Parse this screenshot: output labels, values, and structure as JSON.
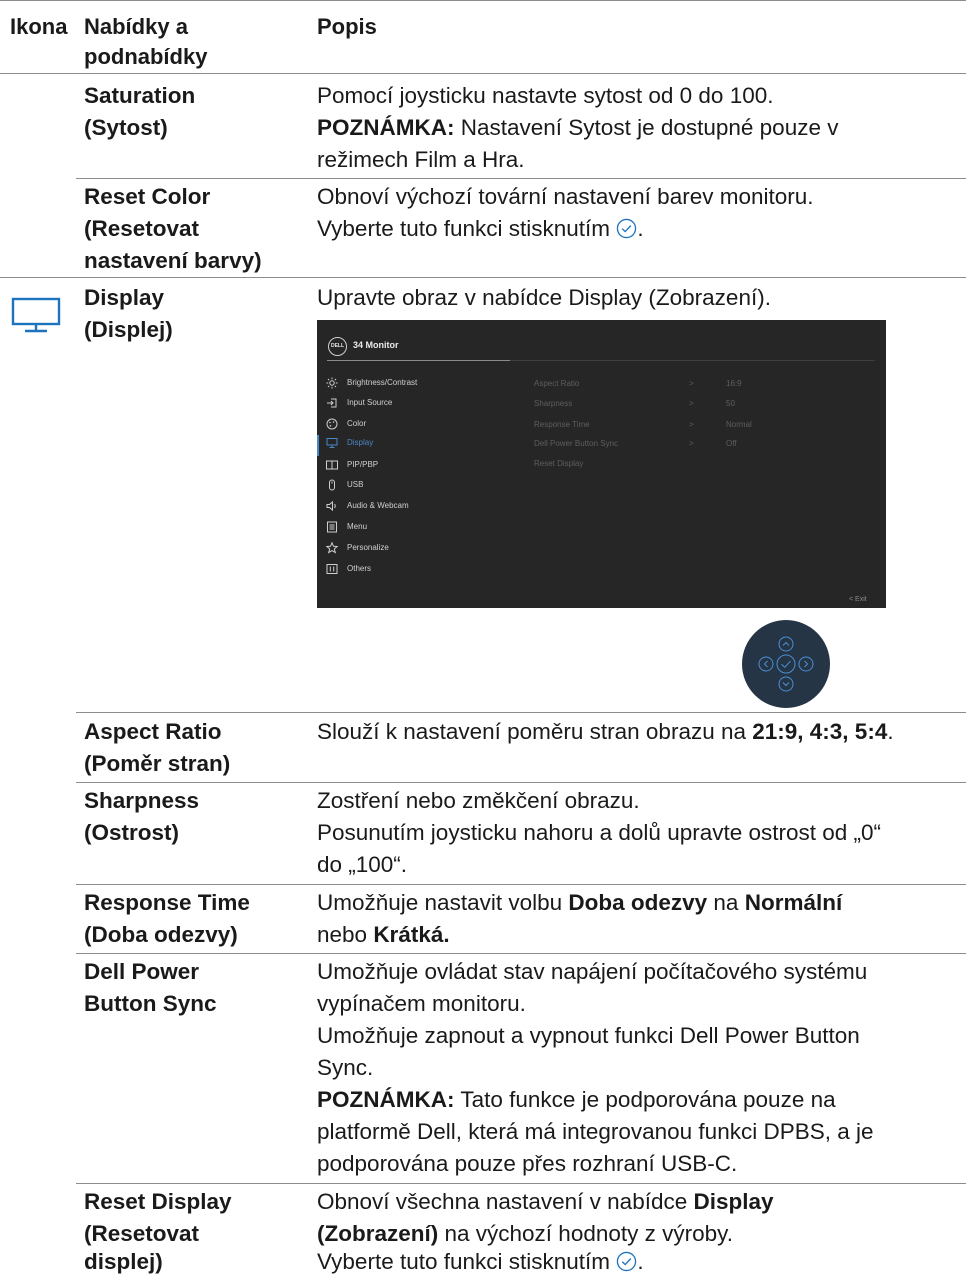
{
  "header": {
    "col_icon": "Ikona",
    "col_menu_l1": "Nabídky a",
    "col_menu_l2": "podnabídky",
    "col_desc": "Popis"
  },
  "rows": {
    "saturation": {
      "name_l1": "Saturation",
      "name_l2": "(Sytost)",
      "desc_l1": "Pomocí joysticku nastavte sytost od 0 do 100.",
      "note_label": "POZNÁMKA:",
      "note_l1": " Nastavení Sytost je dostupné pouze v",
      "note_l2": "režimech Film a Hra."
    },
    "reset_color": {
      "name_l1": "Reset Color",
      "name_l2": "(Resetovat",
      "name_l3": "nastavení barvy)",
      "desc_l1": "Obnoví výchozí tovární nastavení barev monitoru.",
      "desc_l2": "Vyberte tuto funkci stisknutím",
      "desc_l2_end": "."
    },
    "display": {
      "name_l1": "Display",
      "name_l2": "(Displej)",
      "desc_l1": "Upravte obraz v nabídce Display (Zobrazení).",
      "icon": "monitor-icon"
    },
    "aspect_ratio": {
      "name_l1": "Aspect Ratio",
      "name_l2": "(Poměr stran)",
      "desc_pre": "Slouží k nastavení poměru stran obrazu na ",
      "desc_bold": "21:9, 4:3, 5:4",
      "desc_post": "."
    },
    "sharpness": {
      "name_l1": "Sharpness",
      "name_l2": "(Ostrost)",
      "desc_l1": "Zostření nebo změkčení obrazu.",
      "desc_l2": "Posunutím joysticku nahoru a dolů upravte ostrost od „0“",
      "desc_l3": "do „100“."
    },
    "response_time": {
      "name_l1": "Response Time",
      "name_l2": "(Doba odezvy)",
      "desc_pre": "Umožňuje nastavit volbu ",
      "desc_b1": "Doba odezvy",
      "desc_mid": " na ",
      "desc_b2": "Normální",
      "desc_l2_pre": "nebo ",
      "desc_l2_b": "Krátká."
    },
    "dpbs": {
      "name_l1": "Dell Power",
      "name_l2": "Button Sync",
      "desc_l1": "Umožňuje ovládat stav napájení počítačového systému",
      "desc_l2": "vypínačem monitoru.",
      "desc_l3": "Umožňuje zapnout a vypnout funkci Dell Power Button",
      "desc_l4": "Sync.",
      "note_label": "POZNÁMKA:",
      "note_l1": " Tato funkce je podporována pouze na",
      "note_l2": "platformě Dell, která má integrovanou funkci DPBS, a je",
      "note_l3": "podporována pouze přes rozhraní USB-C."
    },
    "reset_display": {
      "name_l1": "Reset Display",
      "name_l2": "(Resetovat",
      "name_l3": "displej)",
      "desc_l1_pre": "Obnoví všechna nastavení v nabídce ",
      "desc_l1_b": "Display",
      "desc_l2_b": "(Zobrazení)",
      "desc_l2_post": " na výchozí hodnoty z výroby.",
      "desc_l3": "Vyberte tuto funkci stisknutím",
      "desc_l3_end": "."
    }
  },
  "osd": {
    "logo": "DELL",
    "title": "34 Monitor",
    "menu": [
      "Brightness/Contrast",
      "Input Source",
      "Color",
      "Display",
      "PIP/PBP",
      "USB",
      "Audio & Webcam",
      "Menu",
      "Personalize",
      "Others"
    ],
    "selected": "Display",
    "submenu": [
      {
        "label": "Aspect Ratio",
        "arrow": ">",
        "value": "16:9"
      },
      {
        "label": "Sharpness",
        "arrow": ">",
        "value": "50"
      },
      {
        "label": "Response Time",
        "arrow": ">",
        "value": "Normal"
      },
      {
        "label": "Dell Power Button Sync",
        "arrow": ">",
        "value": "Off"
      },
      {
        "label": "Reset Display",
        "arrow": "",
        "value": ""
      }
    ],
    "exit": "<   Exit"
  },
  "colors": {
    "accent_blue": "#1e73be",
    "osd_bg": "#262626",
    "osd_selected": "#4a87c8",
    "joystick_bg": "#253545"
  }
}
